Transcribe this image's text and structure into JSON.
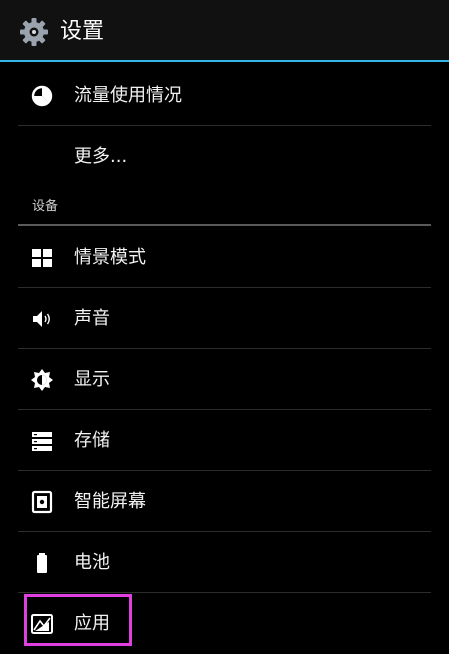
{
  "header": {
    "title": "设置",
    "icon": "gear-icon",
    "accent_color": "#33b5e5"
  },
  "wireless_items": [
    {
      "label": "流量使用情况",
      "icon": "data-usage-icon"
    },
    {
      "label": "更多...",
      "icon": ""
    }
  ],
  "device_section": {
    "header": "设备",
    "items": [
      {
        "label": "情景模式",
        "icon": "grid-icon"
      },
      {
        "label": "声音",
        "icon": "speaker-icon"
      },
      {
        "label": "显示",
        "icon": "brightness-icon"
      },
      {
        "label": "存储",
        "icon": "storage-icon"
      },
      {
        "label": "智能屏幕",
        "icon": "smart-screen-icon"
      },
      {
        "label": "电池",
        "icon": "battery-icon"
      },
      {
        "label": "应用",
        "icon": "apps-icon"
      }
    ]
  },
  "highlight_color": "#e040e0"
}
